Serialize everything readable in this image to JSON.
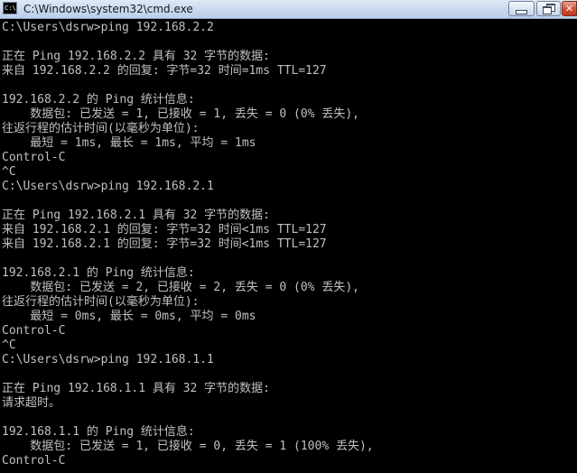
{
  "window": {
    "title": "C:\\Windows\\system32\\cmd.exe",
    "icon_text": "C:\\",
    "controls": {
      "minimize": "minimize-icon",
      "maximize": "maximize-icon",
      "close": "✕"
    }
  },
  "console": {
    "lines": [
      "C:\\Users\\dsrw>ping 192.168.2.2",
      "",
      "正在 Ping 192.168.2.2 具有 32 字节的数据:",
      "来自 192.168.2.2 的回复: 字节=32 时间=1ms TTL=127",
      "",
      "192.168.2.2 的 Ping 统计信息:",
      "    数据包: 已发送 = 1, 已接收 = 1, 丢失 = 0 (0% 丢失),",
      "往返行程的估计时间(以毫秒为单位):",
      "    最短 = 1ms, 最长 = 1ms, 平均 = 1ms",
      "Control-C",
      "^C",
      "C:\\Users\\dsrw>ping 192.168.2.1",
      "",
      "正在 Ping 192.168.2.1 具有 32 字节的数据:",
      "来自 192.168.2.1 的回复: 字节=32 时间<1ms TTL=127",
      "来自 192.168.2.1 的回复: 字节=32 时间<1ms TTL=127",
      "",
      "192.168.2.1 的 Ping 统计信息:",
      "    数据包: 已发送 = 2, 已接收 = 2, 丢失 = 0 (0% 丢失),",
      "往返行程的估计时间(以毫秒为单位):",
      "    最短 = 0ms, 最长 = 0ms, 平均 = 0ms",
      "Control-C",
      "^C",
      "C:\\Users\\dsrw>ping 192.168.1.1",
      "",
      "正在 Ping 192.168.1.1 具有 32 字节的数据:",
      "请求超时。",
      "",
      "192.168.1.1 的 Ping 统计信息:",
      "    数据包: 已发送 = 1, 已接收 = 0, 丢失 = 1 (100% 丢失),",
      "Control-C"
    ]
  }
}
